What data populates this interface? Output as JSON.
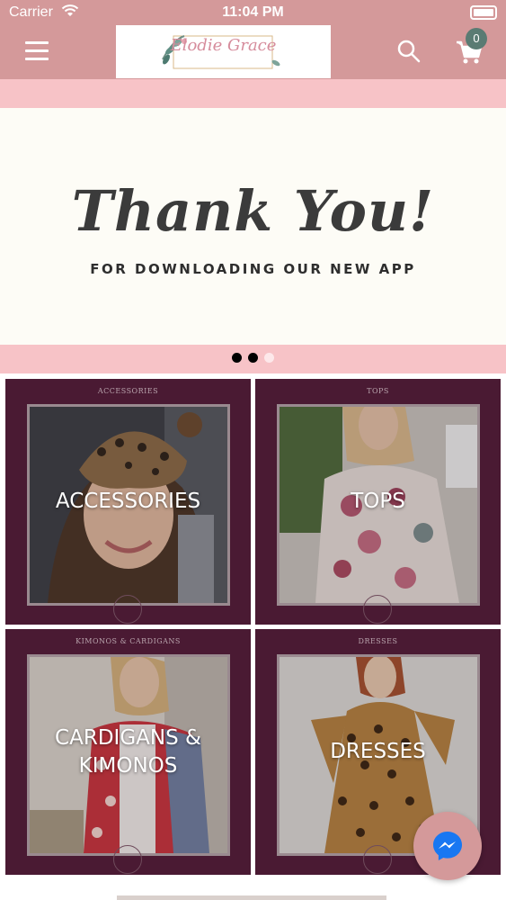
{
  "status_bar": {
    "carrier": "Carrier",
    "time": "11:04 PM"
  },
  "header": {
    "logo_text": "Elodie Grace",
    "cart_count": "0",
    "icons": {
      "menu": "menu-icon",
      "search": "search-icon",
      "cart": "cart-icon"
    }
  },
  "banner": {
    "title": "Thank You!",
    "subtitle": "FOR DOWNLOADING OUR NEW APP",
    "slides": 3,
    "active_slides": [
      true,
      true,
      false
    ]
  },
  "categories": [
    {
      "caption": "ACCESSORIES",
      "label_lines": [
        "ACCESSORIES"
      ]
    },
    {
      "caption": "TOPS",
      "label_lines": [
        "TOPS"
      ]
    },
    {
      "caption": "KIMONOS & CARDIGANS",
      "label_lines": [
        "CARDIGANS &",
        "KIMONOS"
      ]
    },
    {
      "caption": "DRESSES",
      "label_lines": [
        "DRESSES"
      ]
    }
  ],
  "colors": {
    "header": "#d4999a",
    "pink_band": "#f7c3c7",
    "tile_bg": "#4a1a33",
    "badge": "#5a7b73",
    "messenger": "#1877f2"
  },
  "fab": {
    "icon": "messenger-icon"
  }
}
